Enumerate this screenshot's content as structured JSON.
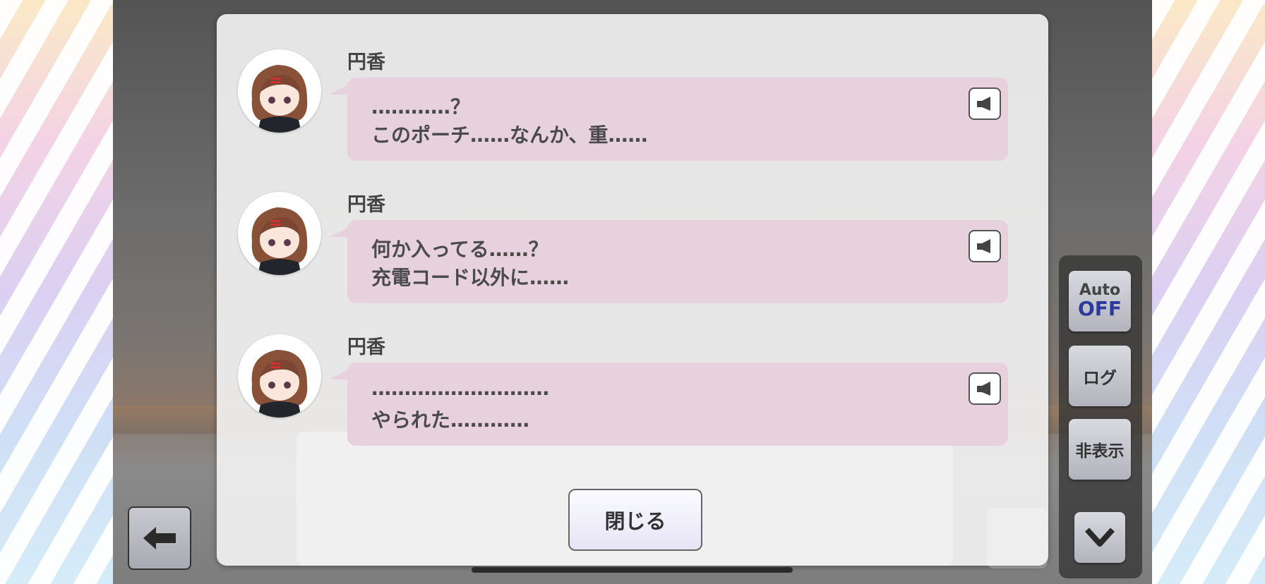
{
  "log": {
    "entries": [
      {
        "speaker": "円香",
        "line1": "…………？",
        "line2": "このポーチ……なんか、重……"
      },
      {
        "speaker": "円香",
        "line1": "何か入ってる……？",
        "line2": "充電コード以外に……"
      },
      {
        "speaker": "円香",
        "line1": "………………………",
        "line2": "やられた…………"
      }
    ],
    "close_label": "閉じる"
  },
  "side": {
    "auto_top": "Auto",
    "auto_state": "OFF",
    "log_label": "ログ",
    "hide_label": "非表示"
  },
  "colors": {
    "bubble": "#e7d1dc",
    "auto_off": "#2d3a9e",
    "panel": "#f0f0f0"
  },
  "icons": [
    "speaker-icon",
    "back-arrow-icon",
    "chevron-down-icon"
  ]
}
